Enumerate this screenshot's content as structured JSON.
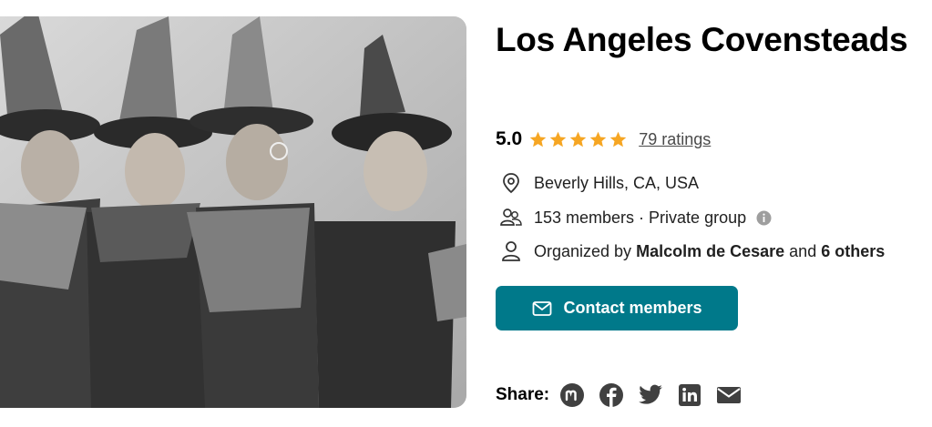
{
  "group": {
    "title": "Los Angeles Covensteads",
    "photo_icon": "vintage-witches-photo",
    "rating_score": "5.0",
    "stars": 5,
    "star_color": "#f6a623",
    "ratings_link": "79 ratings",
    "location": "Beverly Hills, CA, USA",
    "members": "153 members · Private group",
    "organized_prefix": "Organized by",
    "organizer_name": "Malcolm de Cesare",
    "organized_and": "and",
    "organized_others": "6 others"
  },
  "contact_button": {
    "label": "Contact members",
    "color": "#00798a",
    "icon": "mail-icon"
  },
  "share": {
    "label": "Share:",
    "icons": [
      "meetup-icon",
      "facebook-icon",
      "twitter-icon",
      "linkedin-icon",
      "email-icon"
    ]
  }
}
